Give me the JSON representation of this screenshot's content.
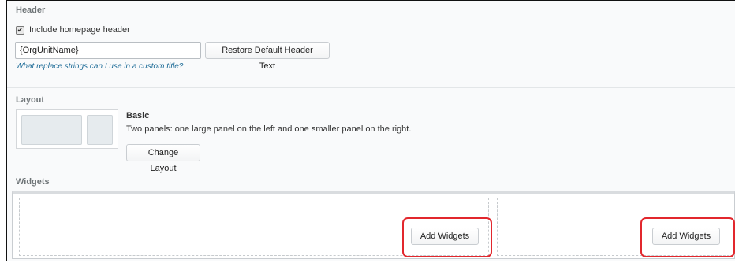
{
  "header_section": {
    "label": "Header",
    "include_checkbox_label": "Include homepage header",
    "include_checked": true,
    "title_value": "{OrgUnitName}",
    "restore_button_label": "Restore Default Header Text",
    "help_link": "What replace strings can I use in a custom title?"
  },
  "layout_section": {
    "label": "Layout",
    "layout_name": "Basic",
    "layout_description": "Two panels: one large panel on the left and one smaller panel on the right.",
    "change_button_label": "Change Layout"
  },
  "widgets_section": {
    "label": "Widgets",
    "panels": [
      {
        "add_button_label": "Add Widgets"
      },
      {
        "add_button_label": "Add Widgets"
      }
    ]
  },
  "colors": {
    "highlight": "#e2272d",
    "link": "#1b6a96",
    "section_label": "#6e7477"
  },
  "icons": {
    "checkbox_mark": "checkmark-icon"
  }
}
